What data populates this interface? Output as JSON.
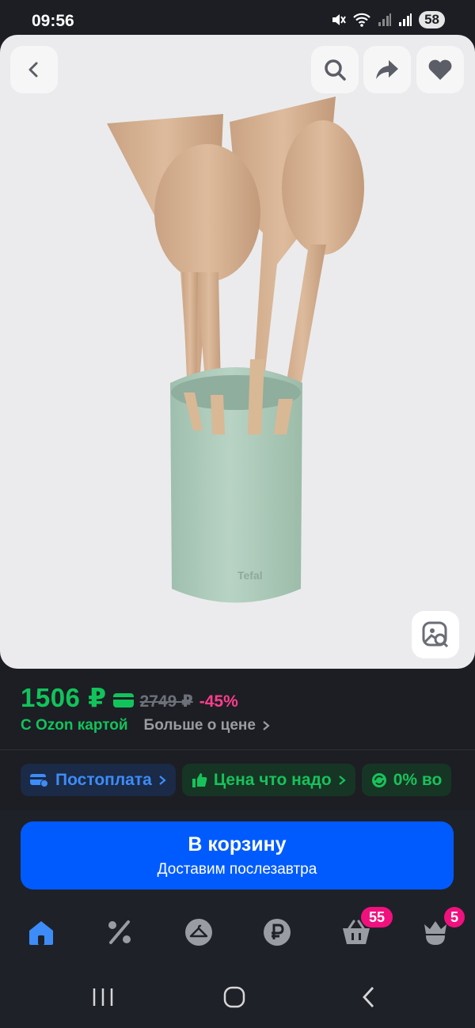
{
  "status_bar": {
    "time": "09:56",
    "battery": "58"
  },
  "price": {
    "current": "1506 ₽",
    "old": "2749 ₽",
    "discount": "-45%",
    "card_label": "С Ozon картой",
    "more_label": "Больше о цене"
  },
  "chips": [
    {
      "label": "Постоплата"
    },
    {
      "label": "Цена что надо"
    },
    {
      "label": "0% во"
    }
  ],
  "cart": {
    "title": "В корзину",
    "subtitle": "Доставим послезавтра"
  },
  "nav": {
    "cart_badge": "55",
    "profile_badge": "5"
  },
  "colors": {
    "accent": "#005bff",
    "price": "#12c35b",
    "discount": "#ff3d8b",
    "background": "#1c1e24"
  },
  "icons": [
    "back-icon",
    "search-icon",
    "share-icon",
    "heart-icon",
    "visual-search-icon",
    "home-icon",
    "percent-icon",
    "hanger-icon",
    "ruble-icon",
    "basket-icon",
    "profile-icon"
  ]
}
